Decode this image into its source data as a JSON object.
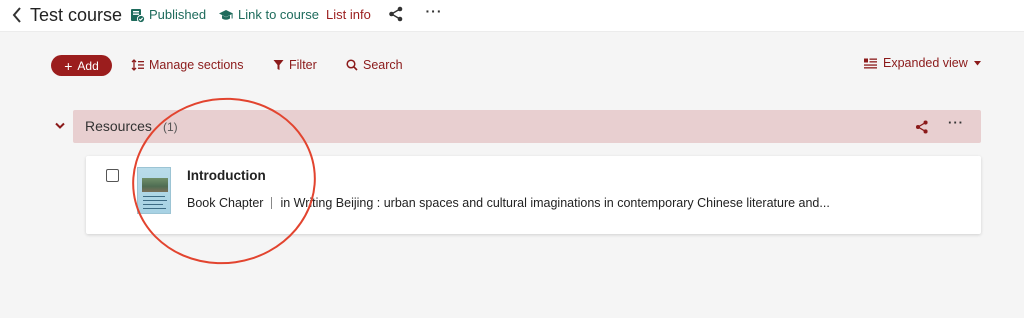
{
  "header": {
    "course_title": "Test course",
    "published_label": "Published",
    "link_label": "Link to course",
    "list_info_label": "List info"
  },
  "toolbar": {
    "add_label": "Add",
    "manage_sections_label": "Manage sections",
    "filter_label": "Filter",
    "search_label": "Search",
    "view_label": "Expanded view"
  },
  "section": {
    "name": "Resources",
    "count": "(1)"
  },
  "items": [
    {
      "title": "Introduction",
      "type": "Book Chapter",
      "source": "in Writing Beijing : urban spaces and cultural imaginations in contemporary Chinese literature and..."
    }
  ],
  "colors": {
    "brand": "#9b1d1d",
    "status_green": "#1e6b5c",
    "section_bg": "#e8cfd0",
    "annotation": "#e2442f"
  },
  "icons": [
    "chevron-left-icon",
    "published-icon",
    "graduation-cap-icon",
    "share-icon",
    "more-icon",
    "plus-icon",
    "sort-icon",
    "filter-icon",
    "search-icon",
    "list-view-icon",
    "caret-down-icon",
    "chevron-down-icon",
    "checkbox-icon",
    "book-cover-thumbnail"
  ]
}
